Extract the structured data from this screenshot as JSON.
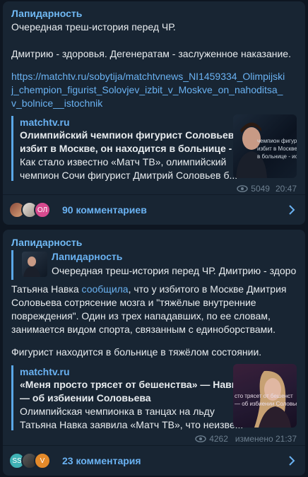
{
  "post1": {
    "channel": "Лапидарность",
    "line1": "Очередная треш-история перед ЧР.",
    "line2": "Дмитрию - здоровья. Дегенератам - заслуженное наказание.",
    "link": "https://matchtv.ru/sobytija/matchtvnews_NI1459334_Olimpijskij_chempion_figurist_Solovjev_izbit_v_Moskve_on_nahoditsa_v_bolnice__istochnik",
    "preview": {
      "site": "matchtv.ru",
      "title1": "Олимпийский чемпион фигурист Соловьев",
      "title2": "избит в Москве, он находится в больнице - ...",
      "desc1": "Как стало известно «Матч ТВ», олимпийский",
      "desc2": "чемпион Сочи фигурист Дмитрий Соловьев б...",
      "thumb_text1": "чемпион фигурист",
      "thumb_text2": "избит в Москве, он нах",
      "thumb_text3": "в больнице - источни"
    },
    "views": "5049",
    "time": "20:47",
    "comments": "90 комментариев",
    "avatar3_initials": "ОЛ"
  },
  "post2": {
    "channel": "Лапидарность",
    "quote_name": "Лапидарность",
    "quote_text": "Очередная треш-история перед ЧР.   Дмитрию - здоро...",
    "body_line1_a": "Татьяна Навка ",
    "body_line1_link": "сообщила",
    "body_line1_b": ", что у избитого в Москве Дмитрия",
    "body_line2": "Соловьева сотрясение мозга и \"тяжёлые внутренние",
    "body_line3": "повреждения\". Один из трех нападавших, по ее словам,",
    "body_line4": "занимается видом спорта, связанным с единоборствами.",
    "body_line5": "Фигурист находится в больнице в тяжёлом состоянии.",
    "preview": {
      "site": "matchtv.ru",
      "title1": "«Меня просто трясет от бешенства» — Навка",
      "title2": "— об избиении Соловьева",
      "desc1": "Олимпийская чемпионка в танцах на льду",
      "desc2": "Татьяна Навка заявила «Матч ТВ», что неизве...",
      "thumb_text1": "сто трясет от бешенст",
      "thumb_text2": "— об избиении Соловьева"
    },
    "views": "4262",
    "edited": "изменено 21:37",
    "comments": "23 комментария",
    "avatar1_initials": "SS",
    "avatar3_initials": "V"
  }
}
